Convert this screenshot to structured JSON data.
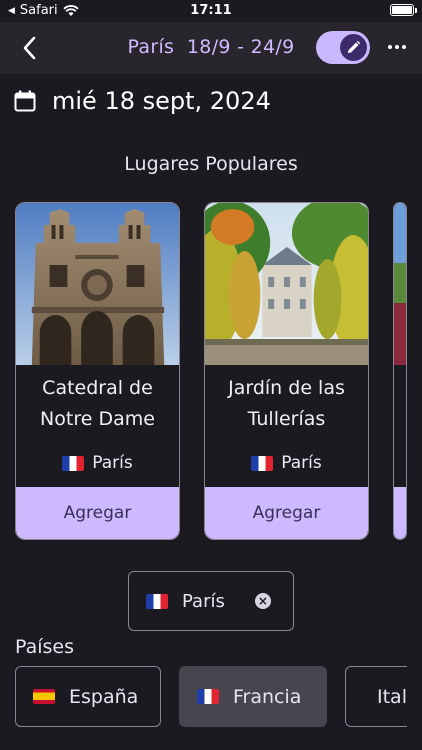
{
  "status_bar": {
    "carrier": "Safari",
    "time": "17:11"
  },
  "nav": {
    "title": "París  18/9 - 24/9"
  },
  "date": {
    "text": "mié 18 sept, 2024"
  },
  "popular": {
    "title": "Lugares Populares",
    "cards": [
      {
        "name": "Catedral de Notre Dame",
        "city": "París",
        "button": "Agregar"
      },
      {
        "name": "Jardín de las Tullerías",
        "city": "París",
        "button": "Agregar"
      }
    ]
  },
  "selected_city": {
    "label": "París"
  },
  "countries": {
    "title": "Países",
    "items": [
      {
        "label": "España",
        "selected": false
      },
      {
        "label": "Francia",
        "selected": true
      },
      {
        "label": "Italia",
        "selected": false
      }
    ]
  },
  "colors": {
    "accent": "#ccb9ff",
    "background": "#1c1a21",
    "nav": "#28252d"
  }
}
